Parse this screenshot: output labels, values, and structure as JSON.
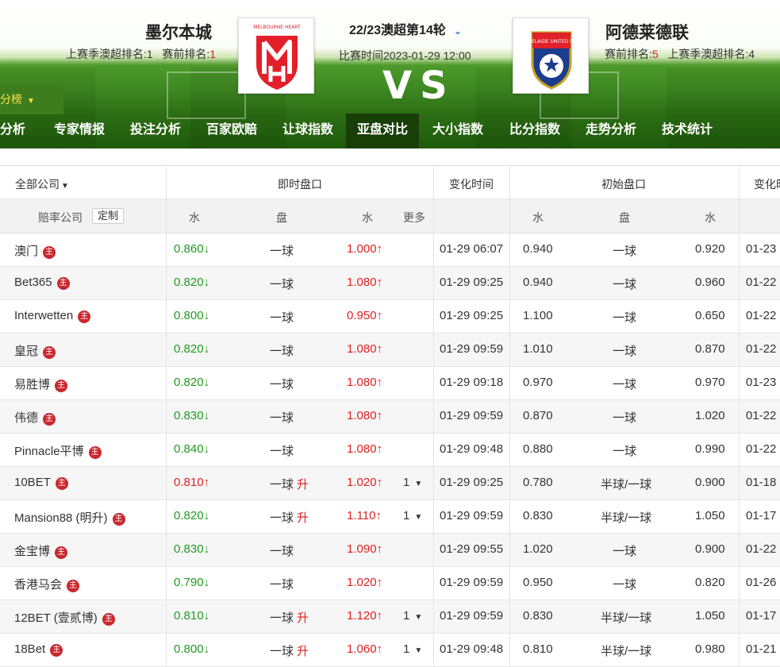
{
  "header": {
    "home": {
      "name": "墨尔本城",
      "rank_label_last": "上赛季澳超排名:1",
      "rank_label": "赛前排名:",
      "rank_value": "1",
      "logo_text": "MELBOURNE HEART"
    },
    "away": {
      "name": "阿德莱德联",
      "rank_label": "赛前排名:",
      "rank_value": "5",
      "rank_label_last": "上赛季澳超排名:4",
      "logo_text": "ADELAIDE UNITED F.C."
    },
    "round": "22/23澳超第14轮",
    "match_time": "比赛时间2023-01-29 12:00",
    "vs": "VS",
    "standings_tab": "分榜"
  },
  "nav": [
    "分析",
    "专家情报",
    "投注分析",
    "百家欧赔",
    "让球指数",
    "亚盘对比",
    "大小指数",
    "比分指数",
    "走势分析",
    "技术统计"
  ],
  "nav_active": 5,
  "table": {
    "h_company": "全部公司",
    "h_live": "即时盘口",
    "h_change_time": "变化时间",
    "h_initial": "初始盘口",
    "h_change_time2": "变化时",
    "sub_company": "赔率公司",
    "sub_custom": "定制",
    "sub_water1": "水",
    "sub_handicap": "盘",
    "sub_water2": "水",
    "sub_more": "更多",
    "sub_init_water1": "水",
    "sub_init_handicap": "盘",
    "sub_init_water2": "水",
    "host_badge": "主",
    "rows": [
      {
        "company": "澳门",
        "w1": "0.860↓",
        "w1c": "green",
        "hcp": "一球",
        "up": "",
        "w2": "1.000↑",
        "w2c": "red",
        "more": "",
        "time": "01-29 06:07",
        "iw1": "0.940",
        "ihcp": "一球",
        "iw2": "0.920",
        "itime": "01-23"
      },
      {
        "company": "Bet365",
        "w1": "0.820↓",
        "w1c": "green",
        "hcp": "一球",
        "up": "",
        "w2": "1.080↑",
        "w2c": "red",
        "more": "",
        "time": "01-29 09:25",
        "iw1": "0.940",
        "ihcp": "一球",
        "iw2": "0.960",
        "itime": "01-22"
      },
      {
        "company": "Interwetten",
        "w1": "0.800↓",
        "w1c": "green",
        "hcp": "一球",
        "up": "",
        "w2": "0.950↑",
        "w2c": "red",
        "more": "",
        "time": "01-29 09:25",
        "iw1": "1.100",
        "ihcp": "一球",
        "iw2": "0.650",
        "itime": "01-22"
      },
      {
        "company": "皇冠",
        "w1": "0.820↓",
        "w1c": "green",
        "hcp": "一球",
        "up": "",
        "w2": "1.080↑",
        "w2c": "red",
        "more": "",
        "time": "01-29 09:59",
        "iw1": "1.010",
        "ihcp": "一球",
        "iw2": "0.870",
        "itime": "01-22"
      },
      {
        "company": "易胜博",
        "w1": "0.820↓",
        "w1c": "green",
        "hcp": "一球",
        "up": "",
        "w2": "1.080↑",
        "w2c": "red",
        "more": "",
        "time": "01-29 09:18",
        "iw1": "0.970",
        "ihcp": "一球",
        "iw2": "0.970",
        "itime": "01-23"
      },
      {
        "company": "伟德",
        "w1": "0.830↓",
        "w1c": "green",
        "hcp": "一球",
        "up": "",
        "w2": "1.080↑",
        "w2c": "red",
        "more": "",
        "time": "01-29 09:59",
        "iw1": "0.870",
        "ihcp": "一球",
        "iw2": "1.020",
        "itime": "01-22"
      },
      {
        "company": "Pinnacle平博",
        "w1": "0.840↓",
        "w1c": "green",
        "hcp": "一球",
        "up": "",
        "w2": "1.080↑",
        "w2c": "red",
        "more": "",
        "time": "01-29 09:48",
        "iw1": "0.880",
        "ihcp": "一球",
        "iw2": "0.990",
        "itime": "01-22"
      },
      {
        "company": "10BET",
        "w1": "0.810↑",
        "w1c": "red",
        "hcp": "一球",
        "up": "升",
        "w2": "1.020↑",
        "w2c": "red",
        "more": "1",
        "time": "01-29 09:25",
        "iw1": "0.780",
        "ihcp": "半球/一球",
        "iw2": "0.900",
        "itime": "01-18"
      },
      {
        "company": "Mansion88 (明升)",
        "w1": "0.820↓",
        "w1c": "green",
        "hcp": "一球",
        "up": "升",
        "w2": "1.110↑",
        "w2c": "red",
        "more": "1",
        "time": "01-29 09:59",
        "iw1": "0.830",
        "ihcp": "半球/一球",
        "iw2": "1.050",
        "itime": "01-17"
      },
      {
        "company": "金宝博",
        "w1": "0.830↓",
        "w1c": "green",
        "hcp": "一球",
        "up": "",
        "w2": "1.090↑",
        "w2c": "red",
        "more": "",
        "time": "01-29 09:55",
        "iw1": "1.020",
        "ihcp": "一球",
        "iw2": "0.900",
        "itime": "01-22"
      },
      {
        "company": "香港马会",
        "w1": "0.790↓",
        "w1c": "green",
        "hcp": "一球",
        "up": "",
        "w2": "1.020↑",
        "w2c": "red",
        "more": "",
        "time": "01-29 09:59",
        "iw1": "0.950",
        "ihcp": "一球",
        "iw2": "0.820",
        "itime": "01-26"
      },
      {
        "company": "12BET (壹贰博)",
        "w1": "0.810↓",
        "w1c": "green",
        "hcp": "一球",
        "up": "升",
        "w2": "1.120↑",
        "w2c": "red",
        "more": "1",
        "time": "01-29 09:59",
        "iw1": "0.830",
        "ihcp": "半球/一球",
        "iw2": "1.050",
        "itime": "01-17"
      },
      {
        "company": "18Bet",
        "w1": "0.800↓",
        "w1c": "green",
        "hcp": "一球",
        "up": "升",
        "w2": "1.060↑",
        "w2c": "red",
        "more": "1",
        "time": "01-29 09:48",
        "iw1": "0.810",
        "ihcp": "半球/一球",
        "iw2": "0.980",
        "itime": "01-21"
      }
    ]
  },
  "colors": {
    "up": "#e02020",
    "down": "#1f9b1f",
    "nav_active": "#173f07",
    "badge": "#c9272d"
  }
}
